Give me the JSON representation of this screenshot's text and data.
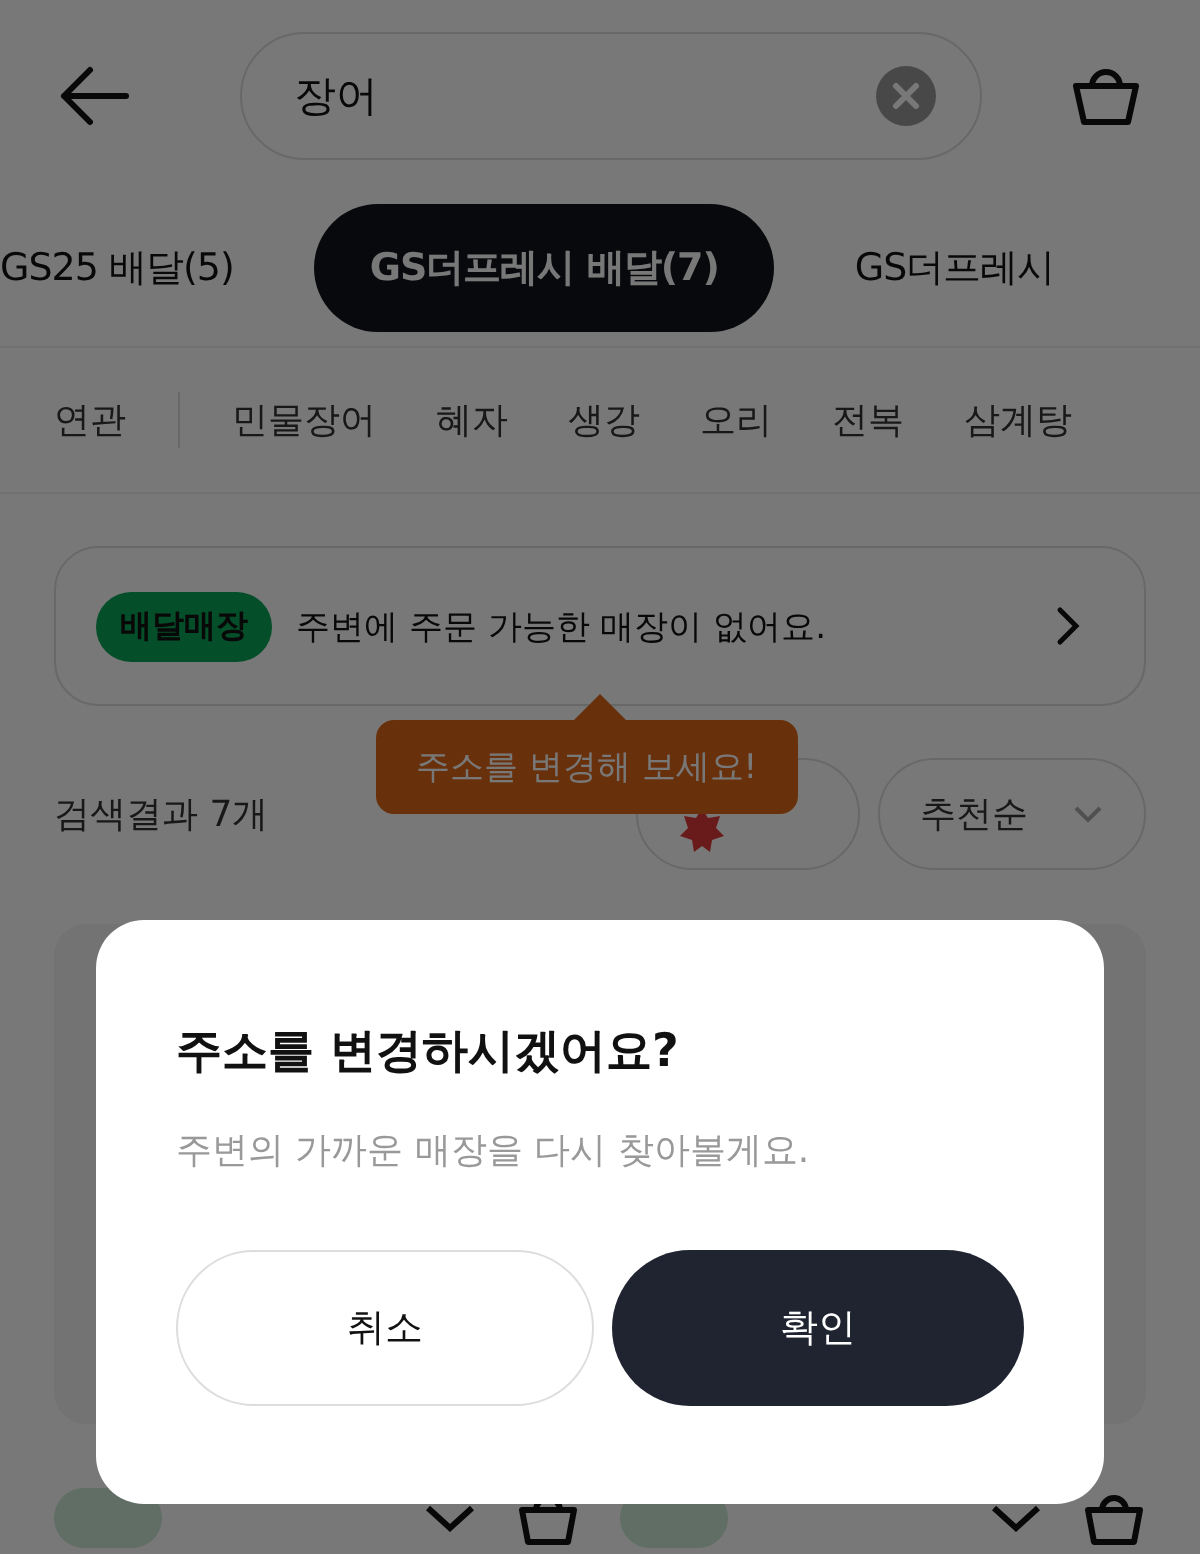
{
  "search": {
    "value": "장어"
  },
  "tabs": [
    {
      "label": "GS25 배달(5)",
      "selected": false
    },
    {
      "label": "GS더프레시 배달(7)",
      "selected": true
    },
    {
      "label": "GS더프레시",
      "selected": false
    }
  ],
  "keywords": [
    {
      "label": "연관",
      "kind": "header"
    },
    {
      "label": "민물장어",
      "kind": "chip"
    },
    {
      "label": "혜자",
      "kind": "chip"
    },
    {
      "label": "생강",
      "kind": "chip"
    },
    {
      "label": "오리",
      "kind": "chip"
    },
    {
      "label": "전복",
      "kind": "chip"
    },
    {
      "label": "삼계탕",
      "kind": "chip"
    }
  ],
  "store_banner": {
    "badge": "배달매장",
    "message": "주변에 주문 가능한 매장이 없어요."
  },
  "tooltip": "주소를 변경해 보세요!",
  "results": {
    "count": "검색결과 7개",
    "sort": "추천순"
  },
  "dialog": {
    "title": "주소를 변경하시겠어요?",
    "message": "주변의 가까운 매장을 다시 찾아볼게요.",
    "buttons": [
      {
        "label": "취소",
        "kind": "secondary"
      },
      {
        "label": "확인",
        "kind": "primary"
      }
    ]
  }
}
